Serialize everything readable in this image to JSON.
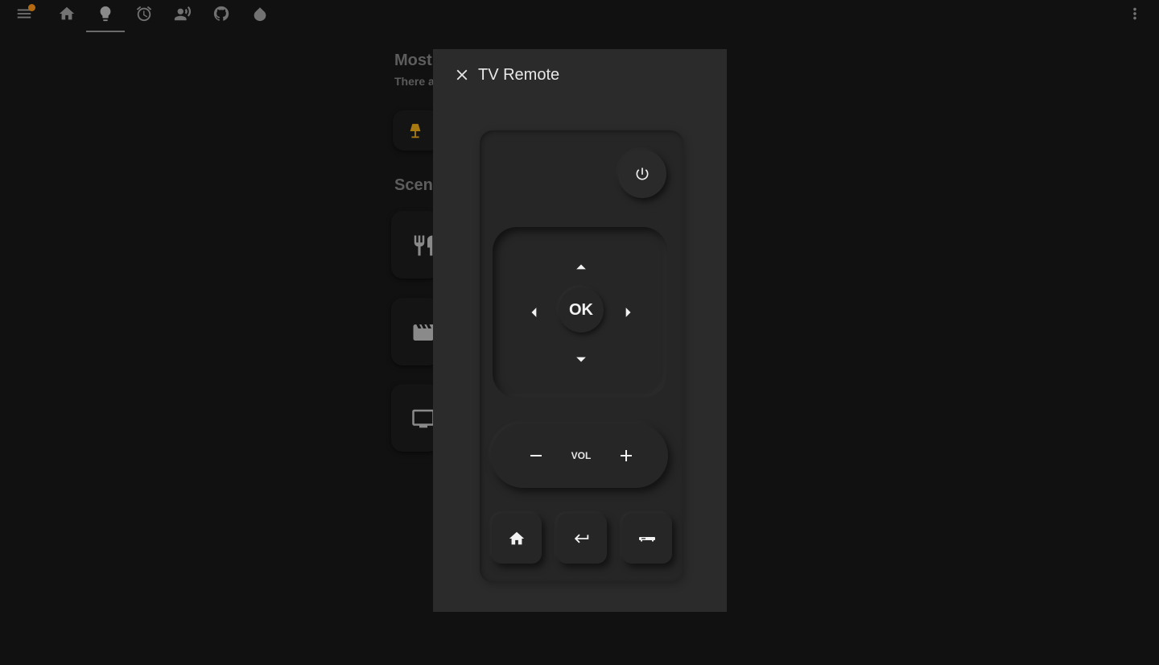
{
  "toolbar": {
    "icons": [
      "menu-icon",
      "home-icon",
      "lightbulb-icon",
      "alarm-icon",
      "voice-icon",
      "github-icon",
      "water-drop-icon",
      "more-vert-icon"
    ],
    "active_tab": "lightbulb-icon",
    "notification_color": "#b36a10"
  },
  "background": {
    "heading": "Most",
    "subheading": "There a",
    "scenes_heading": "Scene",
    "lamp_color": "#b8860b"
  },
  "dialog": {
    "title": "TV Remote",
    "close_icon": "close-icon"
  },
  "remote": {
    "power_icon": "power-icon",
    "ok_label": "OK",
    "vol_label": "VOL",
    "home_icon": "home-icon",
    "back_icon": "return-icon",
    "source_icon": "set-top-box-icon"
  }
}
